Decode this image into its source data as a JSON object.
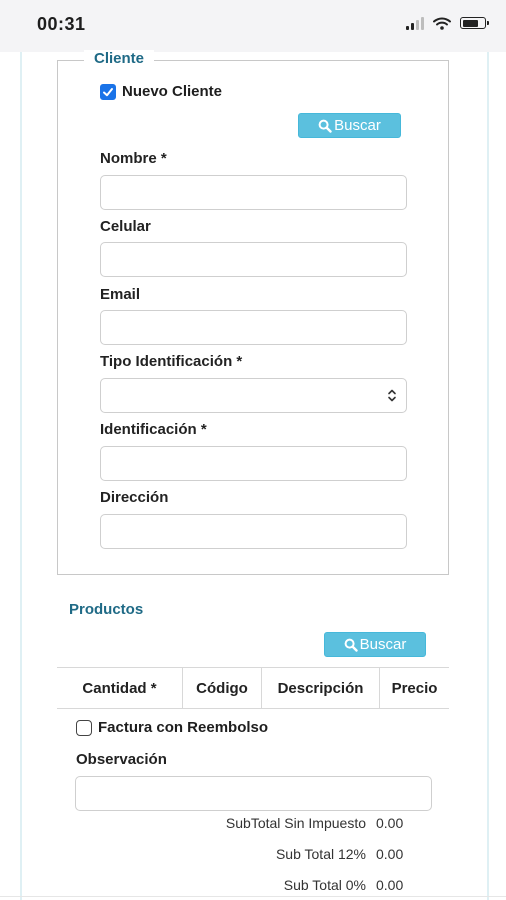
{
  "status_bar": {
    "time": "00:31"
  },
  "cliente": {
    "legend": "Cliente",
    "nuevo_cliente": {
      "label": "Nuevo Cliente",
      "checked": true
    },
    "buscar_label": "Buscar",
    "fields": {
      "nombre": {
        "label": "Nombre *",
        "value": ""
      },
      "celular": {
        "label": "Celular",
        "value": ""
      },
      "email": {
        "label": "Email",
        "value": ""
      },
      "tipo_identificacion": {
        "label": "Tipo Identificación *",
        "selected": ""
      },
      "identificacion": {
        "label": "Identificación *",
        "value": ""
      },
      "direccion": {
        "label": "Dirección",
        "value": ""
      }
    }
  },
  "productos": {
    "title": "Productos",
    "buscar_label": "Buscar",
    "columns": [
      "Cantidad *",
      "Código",
      "Descripción",
      "Precio"
    ]
  },
  "factura_reembolso": {
    "label": "Factura con Reembolso",
    "checked": false
  },
  "observacion": {
    "label": "Observación",
    "value": ""
  },
  "totals": [
    {
      "label": "SubTotal Sin Impuesto",
      "value": "0.00"
    },
    {
      "label": "Sub Total 12%",
      "value": "0.00"
    },
    {
      "label": "Sub Total 0%",
      "value": "0.00"
    }
  ],
  "colors": {
    "accent": "#1f6a86",
    "button": "#5bc0de",
    "checkbox": "#1a73e8"
  }
}
